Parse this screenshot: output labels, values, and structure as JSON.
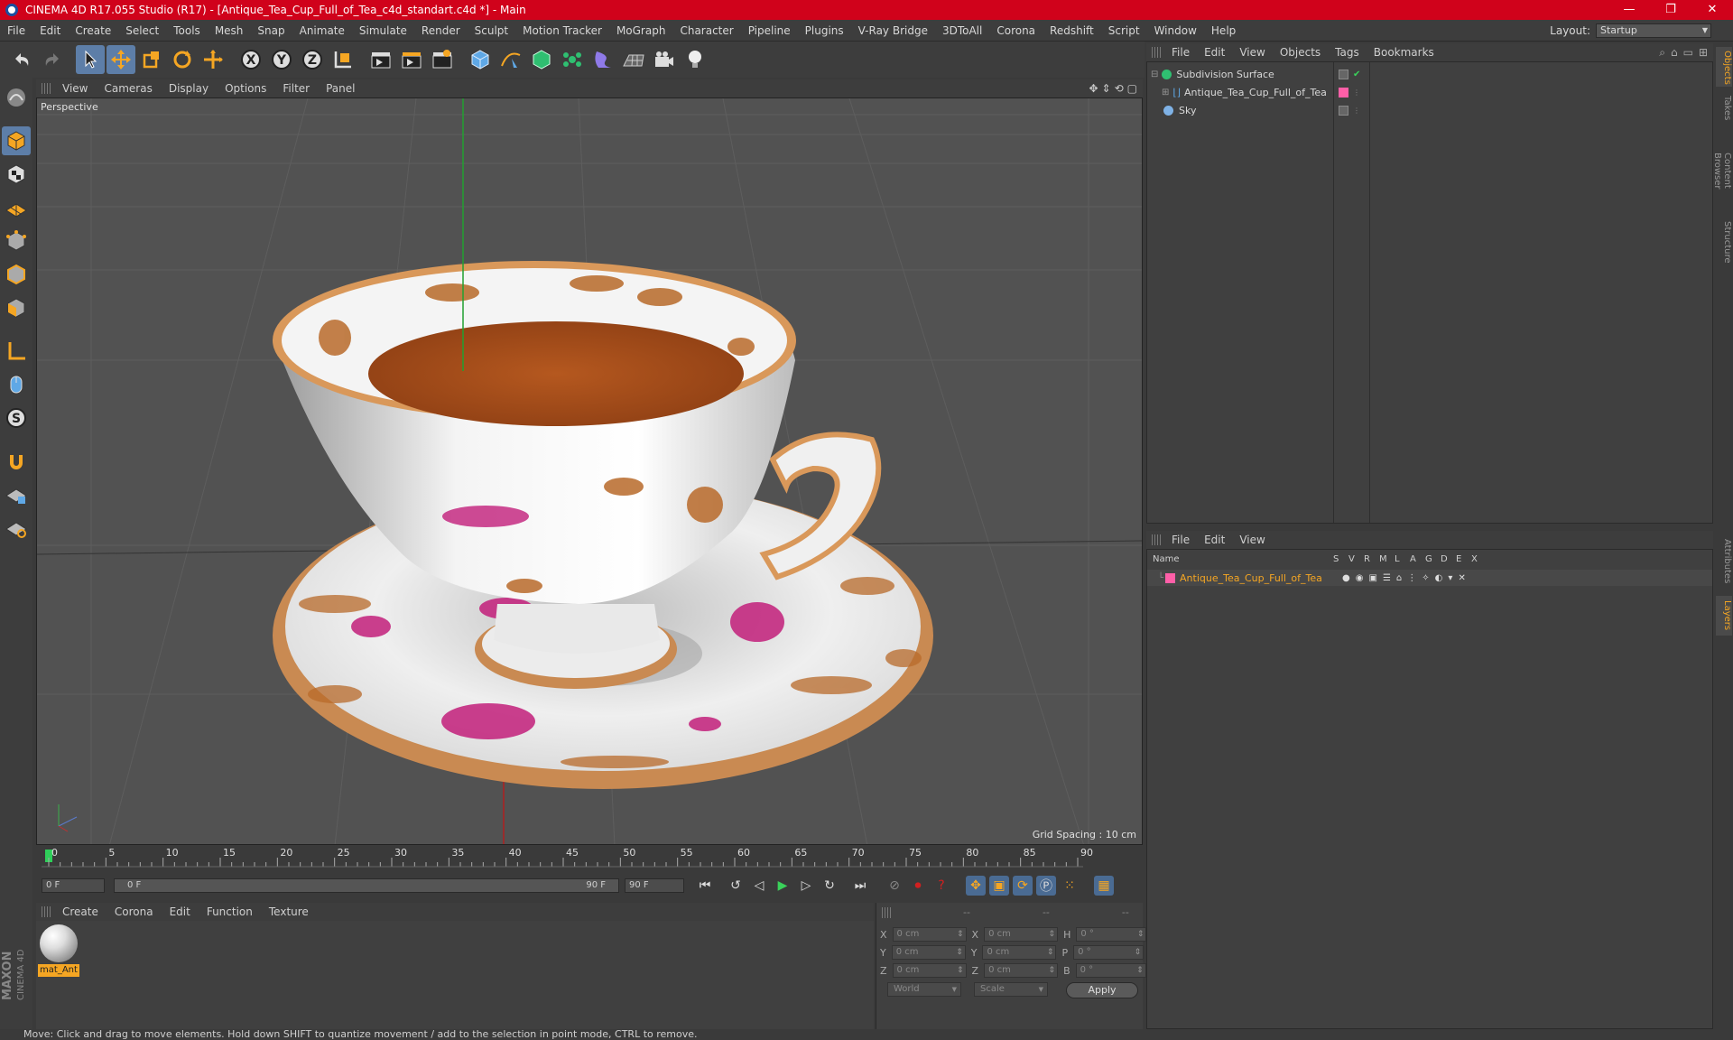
{
  "window": {
    "title": "CINEMA 4D R17.055 Studio (R17) - [Antique_Tea_Cup_Full_of_Tea_c4d_standart.c4d *] - Main"
  },
  "menubar": [
    "File",
    "Edit",
    "Create",
    "Select",
    "Tools",
    "Mesh",
    "Snap",
    "Animate",
    "Simulate",
    "Render",
    "Sculpt",
    "Motion Tracker",
    "MoGraph",
    "Character",
    "Pipeline",
    "Plugins",
    "V-Ray Bridge",
    "3DToAll",
    "Corona",
    "Redshift",
    "Script",
    "Window",
    "Help"
  ],
  "layout": {
    "label": "Layout:",
    "value": "Startup"
  },
  "viewport": {
    "menu": [
      "View",
      "Cameras",
      "Display",
      "Options",
      "Filter",
      "Panel"
    ],
    "label": "Perspective",
    "grid_spacing": "Grid Spacing : 10 cm"
  },
  "timeline": {
    "ticks": [
      "0",
      "5",
      "10",
      "15",
      "20",
      "25",
      "30",
      "35",
      "40",
      "45",
      "50",
      "55",
      "60",
      "65",
      "70",
      "75",
      "80",
      "85",
      "90"
    ],
    "current_frame": "0 F",
    "start_field": "0 F",
    "range_start": "0 F",
    "range_end": "90 F",
    "end_field": "90 F"
  },
  "material_manager": {
    "menu": [
      "Create",
      "Corona",
      "Edit",
      "Function",
      "Texture"
    ],
    "material_name": "mat_Ant"
  },
  "coordinates": {
    "headers": [
      "--",
      "--",
      "--"
    ],
    "rows": [
      {
        "a": "X",
        "av": "0 cm",
        "b": "X",
        "bv": "0 cm",
        "c": "H",
        "cv": "0 °"
      },
      {
        "a": "Y",
        "av": "0 cm",
        "b": "Y",
        "bv": "0 cm",
        "c": "P",
        "cv": "0 °"
      },
      {
        "a": "Z",
        "av": "0 cm",
        "b": "Z",
        "bv": "0 cm",
        "c": "B",
        "cv": "0 °"
      }
    ],
    "world": "World",
    "scale": "Scale",
    "apply": "Apply"
  },
  "object_manager": {
    "menu": [
      "File",
      "Edit",
      "View",
      "Objects",
      "Tags",
      "Bookmarks"
    ],
    "objects": [
      {
        "name": "Subdivision Surface"
      },
      {
        "name": "Antique_Tea_Cup_Full_of_Tea"
      },
      {
        "name": "Sky"
      }
    ]
  },
  "layer_manager": {
    "menu": [
      "File",
      "Edit",
      "View"
    ],
    "head": {
      "name": "Name",
      "cols": [
        "S",
        "V",
        "R",
        "M",
        "L",
        "A",
        "G",
        "D",
        "E",
        "X"
      ]
    },
    "layers": [
      {
        "name": "Antique_Tea_Cup_Full_of_Tea"
      }
    ]
  },
  "right_tabs": [
    "Objects",
    "Takes",
    "Content Browser",
    "Structure",
    "Attributes",
    "Layers"
  ],
  "status": "Move: Click and drag to move elements. Hold down SHIFT to quantize movement / add to the selection in point mode, CTRL to remove.",
  "colors": {
    "title_bar": "#d0021b",
    "accent": "#f5a623",
    "tea": "#a0501e",
    "rim": "#d9985a",
    "highlight_blue": "#5d7ea8"
  }
}
